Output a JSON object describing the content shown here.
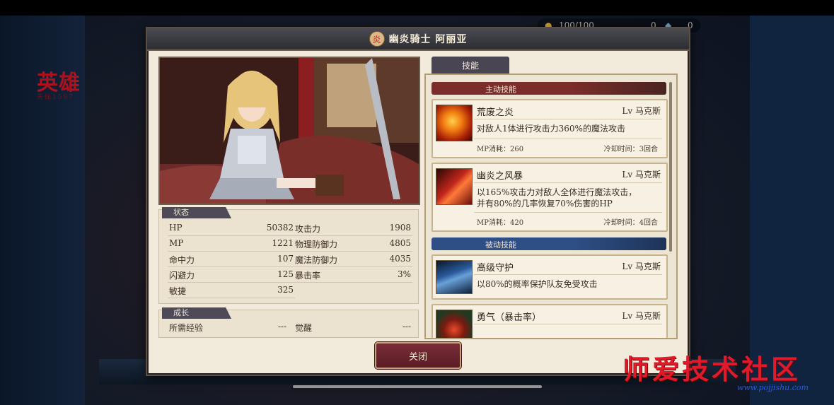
{
  "hero": {
    "title": "英雄",
    "subtitle": "天仙1597"
  },
  "top_resource": {
    "value": "100/100",
    "gems": "0",
    "coins": "0"
  },
  "dialog": {
    "title": "幽炎骑士 阿丽亚",
    "emblem_glyph": "炎"
  },
  "stats": {
    "section_label": "状态",
    "left": [
      {
        "label": "HP",
        "value": "50382"
      },
      {
        "label": "MP",
        "value": "1221"
      },
      {
        "label": "命中力",
        "value": "107"
      },
      {
        "label": "闪避力",
        "value": "125"
      },
      {
        "label": "敏捷",
        "value": "325"
      }
    ],
    "right": [
      {
        "label": "攻击力",
        "value": "1908"
      },
      {
        "label": "物理防御力",
        "value": "4805"
      },
      {
        "label": "魔法防御力",
        "value": "4035"
      },
      {
        "label": "暴击率",
        "value": "3%"
      }
    ]
  },
  "growth": {
    "section_label": "成长",
    "items": [
      {
        "label": "所需经验",
        "value": "---"
      },
      {
        "label": "觉醒",
        "value": "---"
      }
    ]
  },
  "close_button": "关闭",
  "skills": {
    "tab_label": "技能",
    "active_label": "主动技能",
    "passive_label": "被动技能",
    "active": [
      {
        "name": "荒废之炎",
        "level": "Lv 马克斯",
        "desc": "对敌人1体进行攻击力360%的魔法攻击",
        "mp": "MP消耗：260",
        "cd": "冷却时间：3回合",
        "icon": "fire-swirl-icon"
      },
      {
        "name": "幽炎之风暴",
        "level": "Lv 马克斯",
        "desc1": "以165%攻击力对敌人全体进行魔法攻击，",
        "desc2": "并有80%的几率恢复70%伤害的HP",
        "mp": "MP消耗：420",
        "cd": "冷却时间：4回合",
        "icon": "flame-storm-icon"
      }
    ],
    "passive": [
      {
        "name": "高级守护",
        "level": "Lv 马克斯",
        "desc": "以80%的概率保护队友免受攻击",
        "icon": "shield-guard-icon"
      },
      {
        "name": "勇气（暴击率）",
        "level": "Lv 马克斯",
        "icon": "courage-icon"
      }
    ]
  },
  "watermark": {
    "text": "师爱技术社区",
    "url": "www.pojjishu.com"
  },
  "colors": {
    "dialog_bg": "#f2ebdb",
    "header_bg": "#3a3b42",
    "active_head": "#7a2d2a",
    "passive_head": "#2e4f86",
    "close_btn": "#6a2330"
  }
}
